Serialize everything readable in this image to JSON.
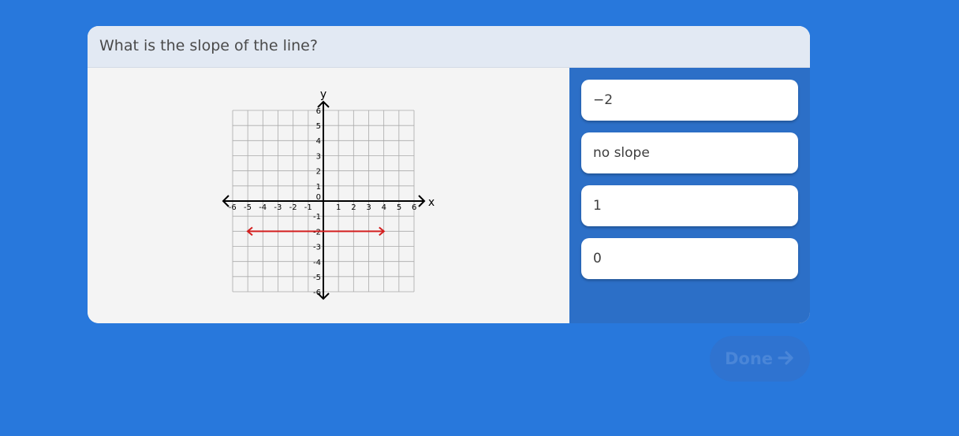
{
  "question": {
    "text": "What is the slope of the line?"
  },
  "graph": {
    "x_axis_label": "x",
    "y_axis_label": "y",
    "x_range": [
      -6,
      6
    ],
    "y_range": [
      -6,
      6
    ],
    "x_ticks": [
      "-6",
      "-5",
      "-4",
      "-3",
      "-2",
      "-1",
      "1",
      "2",
      "3",
      "4",
      "5",
      "6"
    ],
    "y_ticks_positive": [
      "1",
      "2",
      "3",
      "4",
      "5",
      "6"
    ],
    "y_ticks_negative": [
      "-1",
      "-2",
      "-3",
      "-4",
      "-5",
      "-6"
    ],
    "origin_label": "0",
    "line": {
      "color": "#d42020",
      "y_value": -2,
      "x_from": -5,
      "x_to": 4
    }
  },
  "choices": [
    "−2",
    "no slope",
    "1",
    "0"
  ],
  "done_button": {
    "label": "Done"
  },
  "colors": {
    "background": "#2878dc",
    "choices_panel": "#2c6fc7",
    "line": "#d42020"
  }
}
